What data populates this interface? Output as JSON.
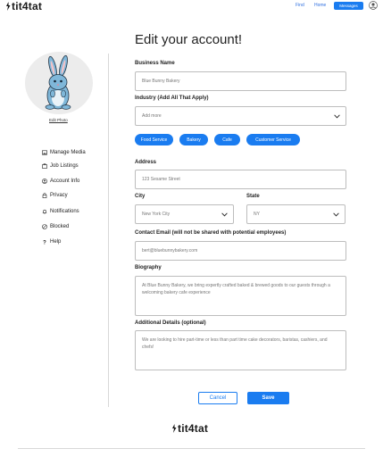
{
  "header": {
    "logo_text": "tit4tat",
    "nav": {
      "find": "Find",
      "home": "Home",
      "messages": "Messages"
    }
  },
  "page_title": "Edit your account!",
  "sidebar": {
    "edit_photo": "Edit Photo",
    "items": [
      {
        "label": "Manage Media",
        "icon": "media-icon"
      },
      {
        "label": "Job Listings",
        "icon": "briefcase-icon"
      },
      {
        "label": "Account Info",
        "icon": "account-icon"
      },
      {
        "label": "Privacy",
        "icon": "lock-icon"
      },
      {
        "label": "Notifications",
        "icon": "bell-icon"
      },
      {
        "label": "Blocked",
        "icon": "blocked-icon"
      },
      {
        "label": "Help",
        "icon": "help-icon"
      }
    ]
  },
  "form": {
    "business_name": {
      "label": "Business Name",
      "value": "Blue Bunny Bakery"
    },
    "industry": {
      "label": "Industry (Add All That Apply)",
      "placeholder": "Add more",
      "tags": [
        "Food Service",
        "Bakery",
        "Cafe",
        "Customer Service"
      ]
    },
    "address": {
      "label": "Address",
      "value": "123 Sesame Street"
    },
    "city": {
      "label": "City",
      "value": "New York City"
    },
    "state": {
      "label": "State",
      "value": "NY"
    },
    "contact_email": {
      "label": "Contact Email (will not be shared with potential employees)",
      "value": "bert@bluebunnybakery.com"
    },
    "biography": {
      "label": "Biography",
      "value": "At Blue Bunny Bakery, we bring expertly crafted baked & brewed goods to our guests through a welcoming bakery cafe experience"
    },
    "additional": {
      "label": "Additional Details (optional)",
      "value": "We are looking to hire part-time or less than part time cake decorators, baristas, cashiers, and chefs!"
    },
    "cancel_label": "Cancel",
    "save_label": "Save"
  },
  "footer": {
    "logo_text": "tit4tat"
  },
  "colors": {
    "accent": "#1a7cf0",
    "bunny": "#7fb7d9"
  }
}
